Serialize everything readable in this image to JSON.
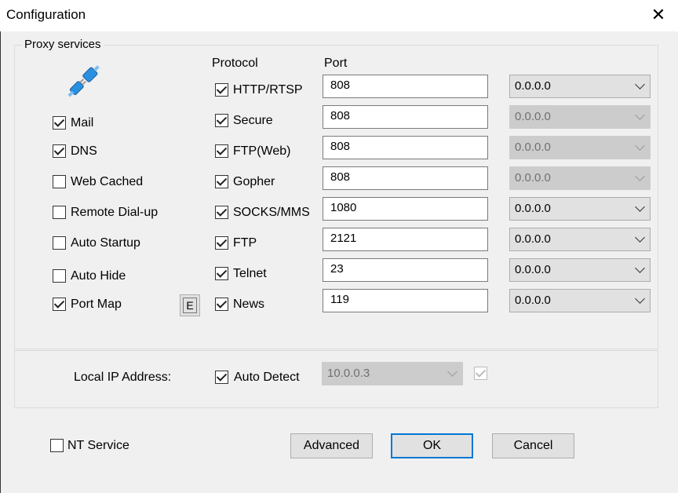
{
  "window": {
    "title": "Configuration",
    "close_glyph": "✕"
  },
  "proxy": {
    "legend": "Proxy services",
    "icon": "plug-connector-icon",
    "services": [
      {
        "label": "Mail",
        "checked": true
      },
      {
        "label": "DNS",
        "checked": true
      },
      {
        "label": "Web Cached",
        "checked": false
      },
      {
        "label": "Remote Dial-up",
        "checked": false
      },
      {
        "label": "Auto Startup",
        "checked": false
      },
      {
        "label": "Auto Hide",
        "checked": false
      },
      {
        "label": "Port Map",
        "checked": true
      }
    ],
    "port_map_edit_label": "E",
    "protocol_header": "Protocol",
    "port_header": "Port",
    "protocols": [
      {
        "label": "HTTP/RTSP",
        "checked": true,
        "port": "808",
        "bind": "0.0.0.0",
        "bind_enabled": true
      },
      {
        "label": "Secure",
        "checked": true,
        "port": "808",
        "bind": "0.0.0.0",
        "bind_enabled": false
      },
      {
        "label": "FTP(Web)",
        "checked": true,
        "port": "808",
        "bind": "0.0.0.0",
        "bind_enabled": false
      },
      {
        "label": "Gopher",
        "checked": true,
        "port": "808",
        "bind": "0.0.0.0",
        "bind_enabled": false
      },
      {
        "label": "SOCKS/MMS",
        "checked": true,
        "port": "1080",
        "bind": "0.0.0.0",
        "bind_enabled": true
      },
      {
        "label": "FTP",
        "checked": true,
        "port": "2121",
        "bind": "0.0.0.0",
        "bind_enabled": true
      },
      {
        "label": "Telnet",
        "checked": true,
        "port": "23",
        "bind": "0.0.0.0",
        "bind_enabled": true
      },
      {
        "label": "News",
        "checked": true,
        "port": "119",
        "bind": "0.0.0.0",
        "bind_enabled": true
      }
    ]
  },
  "local_ip": {
    "label": "Local IP Address:",
    "auto_detect_label": "Auto Detect",
    "auto_detect_checked": true,
    "address": "10.0.0.3",
    "extra_checked": true
  },
  "footer": {
    "nt_service_label": "NT Service",
    "nt_service_checked": false,
    "advanced_label": "Advanced",
    "ok_label": "OK",
    "cancel_label": "Cancel"
  }
}
